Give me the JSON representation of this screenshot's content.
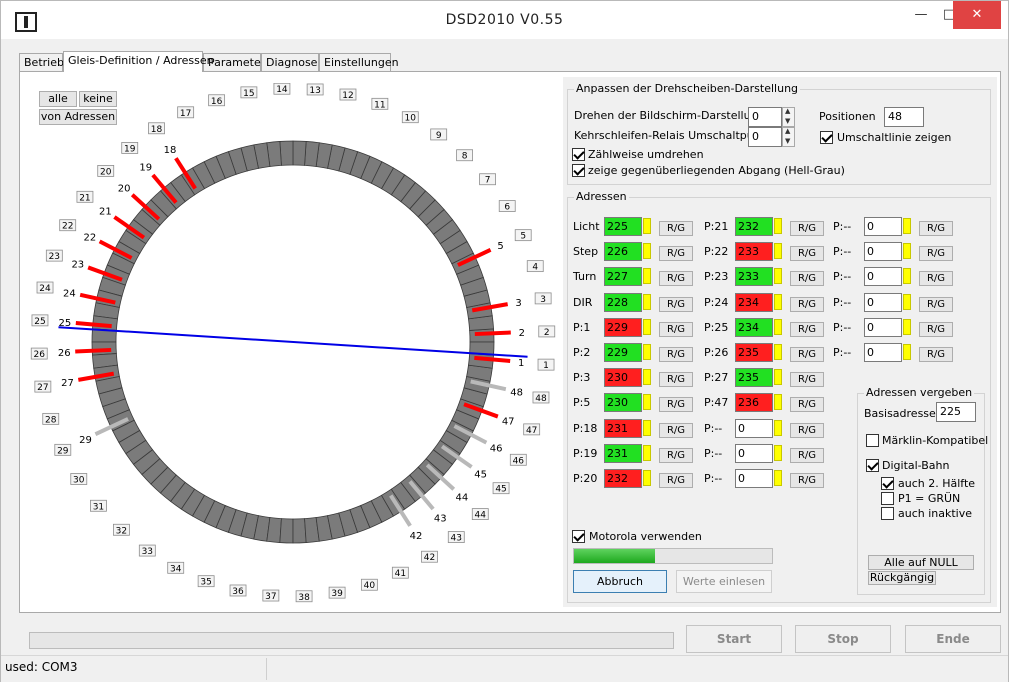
{
  "window": {
    "title": "DSD2010 V0.55",
    "minimize": "—",
    "maximize": "□",
    "close": "✕"
  },
  "tabs": [
    {
      "label": "Betrieb"
    },
    {
      "label": "Gleis-Definition / Adressen"
    },
    {
      "label": "Parameter"
    },
    {
      "label": "Diagnose"
    },
    {
      "label": "Einstellungen"
    }
  ],
  "canvas": {
    "buttons": {
      "all": "alle",
      "none": "keine",
      "from_addresses": "von Adressen"
    },
    "connectors": [
      {
        "n": "1",
        "color": "red"
      },
      {
        "n": "2",
        "color": "red"
      },
      {
        "n": "3",
        "color": "red"
      },
      {
        "n": "5",
        "color": "red"
      },
      {
        "n": "18",
        "color": "red"
      },
      {
        "n": "19",
        "color": "red"
      },
      {
        "n": "20",
        "color": "red"
      },
      {
        "n": "21",
        "color": "red"
      },
      {
        "n": "22",
        "color": "red"
      },
      {
        "n": "23",
        "color": "red"
      },
      {
        "n": "24",
        "color": "red"
      },
      {
        "n": "25",
        "color": "red"
      },
      {
        "n": "26",
        "color": "red"
      },
      {
        "n": "27",
        "color": "red"
      },
      {
        "n": "29",
        "color": "gray"
      },
      {
        "n": "42",
        "color": "gray"
      },
      {
        "n": "43",
        "color": "gray"
      },
      {
        "n": "44",
        "color": "gray"
      },
      {
        "n": "45",
        "color": "gray"
      },
      {
        "n": "46",
        "color": "gray"
      },
      {
        "n": "47",
        "color": "red"
      },
      {
        "n": "48",
        "color": "gray"
      }
    ]
  },
  "display": {
    "title": "Anpassen der Drehscheiben-Darstellung",
    "rotate_label": "Drehen der Bildschirm-Darstellung",
    "rotate_value": "0",
    "relay_label": "Kehrschleifen-Relais Umschaltpunkt",
    "relay_value": "0",
    "positions_label": "Positionen",
    "positions_value": "48",
    "show_switchline": "Umschaltlinie zeigen",
    "count_reverse": "Zählweise umdrehen",
    "show_opposite": "zeige gegenüberliegenden Abgang (Hell-Grau)"
  },
  "addresses": {
    "title": "Adressen",
    "rg_label": "R/G",
    "col1": [
      {
        "label": "Licht",
        "value": "225",
        "state": "green"
      },
      {
        "label": "Step",
        "value": "226",
        "state": "green"
      },
      {
        "label": "Turn",
        "value": "227",
        "state": "green"
      },
      {
        "label": "DIR",
        "value": "228",
        "state": "green"
      },
      {
        "label": "P:1",
        "value": "229",
        "state": "red"
      },
      {
        "label": "P:2",
        "value": "229",
        "state": "green"
      },
      {
        "label": "P:3",
        "value": "230",
        "state": "red"
      },
      {
        "label": "P:5",
        "value": "230",
        "state": "green"
      },
      {
        "label": "P:18",
        "value": "231",
        "state": "red"
      },
      {
        "label": "P:19",
        "value": "231",
        "state": "green"
      },
      {
        "label": "P:20",
        "value": "232",
        "state": "red"
      }
    ],
    "col2": [
      {
        "label": "P:21",
        "value": "232",
        "state": "green"
      },
      {
        "label": "P:22",
        "value": "233",
        "state": "red"
      },
      {
        "label": "P:23",
        "value": "233",
        "state": "green"
      },
      {
        "label": "P:24",
        "value": "234",
        "state": "red"
      },
      {
        "label": "P:25",
        "value": "234",
        "state": "green"
      },
      {
        "label": "P:26",
        "value": "235",
        "state": "red"
      },
      {
        "label": "P:27",
        "value": "235",
        "state": "green"
      },
      {
        "label": "P:47",
        "value": "236",
        "state": "red"
      },
      {
        "label": "P:--",
        "value": "0",
        "state": "white"
      },
      {
        "label": "P:--",
        "value": "0",
        "state": "white"
      },
      {
        "label": "P:--",
        "value": "0",
        "state": "white"
      }
    ],
    "col3": [
      {
        "label": "P:--",
        "value": "0",
        "state": "white"
      },
      {
        "label": "P:--",
        "value": "0",
        "state": "white"
      },
      {
        "label": "P:--",
        "value": "0",
        "state": "white"
      },
      {
        "label": "P:--",
        "value": "0",
        "state": "white"
      },
      {
        "label": "P:--",
        "value": "0",
        "state": "white"
      },
      {
        "label": "P:--",
        "value": "0",
        "state": "white"
      }
    ],
    "motorola": "Motorola verwenden",
    "progress": 0.41,
    "cancel": "Abbruch",
    "read_values": "Werte einlesen"
  },
  "assign": {
    "title": "Adressen vergeben",
    "base_label": "Basisadresse",
    "base_value": "225",
    "maerklin": "Märklin-Kompatibel",
    "digital": "Digital-Bahn",
    "half": "auch 2. Hälfte",
    "p1green": "P1 = GRÜN",
    "inactive": "auch inaktive",
    "all_null": "Alle auf NULL",
    "undo": "Rückgängig"
  },
  "bottom": {
    "start": "Start",
    "stop": "Stop",
    "end": "Ende"
  },
  "status": {
    "text": "used: COM3"
  }
}
